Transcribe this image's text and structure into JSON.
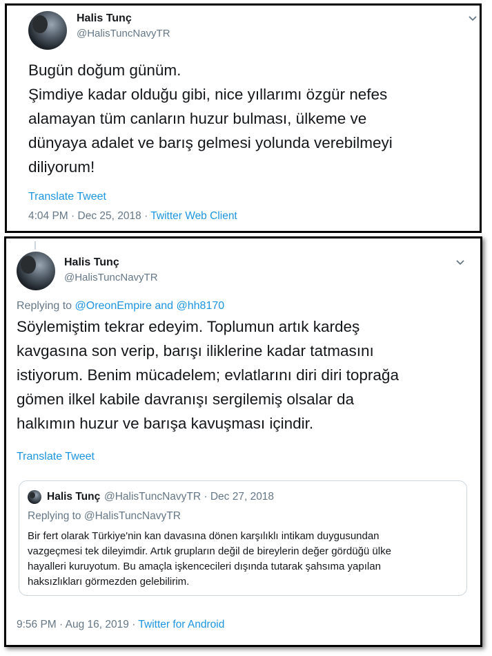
{
  "tweet1": {
    "author_name": "Halis Tunç",
    "author_handle": "@HalisTuncNavyTR",
    "text_lines": [
      "Bugün doğum günüm.",
      "Şimdiye kadar olduğu gibi, nice yıllarımı özgür nefes",
      "alamayan tüm canların huzur bulması, ülkeme ve",
      "dünyaya adalet ve barış gelmesi yolunda verebilmeyi",
      "diliyorum!"
    ],
    "translate_label": "Translate Tweet",
    "time": "4:04 PM",
    "date": "Dec 25, 2018",
    "source": "Twitter Web Client",
    "separator": "·"
  },
  "tweet2": {
    "author_name": "Halis Tunç",
    "author_handle": "@HalisTuncNavyTR",
    "replying_prefix": "Replying to",
    "reply_mention_1": "@OreonEmpire",
    "reply_and": "and",
    "reply_mention_2": "@hh8170",
    "text_lines": [
      "Söylemiştim tekrar edeyim. Toplumun artık kardeş",
      "kavgasına son verip, barışı iliklerine kadar tatmasını",
      "istiyorum. Benim mücadelem; evlatlarını diri diri toprağa",
      "gömen ilkel kabile davranışı sergilemiş olsalar da",
      "halkımın huzur ve barışa kavuşması içindir."
    ],
    "translate_label": "Translate Tweet",
    "time": "9:56 PM",
    "date": "Aug 16, 2019",
    "source": "Twitter for Android",
    "separator": "·",
    "quote": {
      "author_name": "Halis Tunç",
      "author_handle": "@HalisTuncNavyTR",
      "separator": "·",
      "date": "Dec 27, 2018",
      "replying_prefix": "Replying to",
      "replying_mention": "@HalisTuncNavyTR",
      "text_lines": [
        "Bir fert olarak Türkiye'nin kan davasına dönen karşılıklı intikam duygusundan",
        "vazgeçmesi tek dileyimdir. Artık grupların değil de bireylerin değer gördüğü ülke",
        "hayalleri kuruyotum. Bu amaçla  işkencecileri dışında tutarak şahsıma yapılan",
        "haksızlıkları görmezden gelebilirim."
      ]
    }
  },
  "colors": {
    "link": "#1b95e0",
    "muted": "#657786",
    "text": "#14171a",
    "border": "#000000"
  },
  "icons": [
    "chevron-down-icon",
    "avatar"
  ]
}
